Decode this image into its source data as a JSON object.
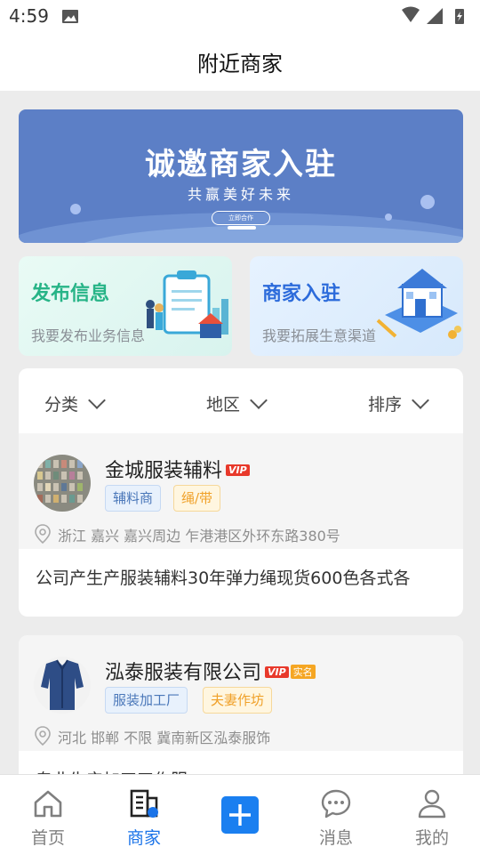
{
  "status": {
    "time": "4:59"
  },
  "header": {
    "title": "附近商家"
  },
  "banner": {
    "title": "诚邀商家入驻",
    "subtitle": "共赢美好未来",
    "button": "立即合作"
  },
  "cards": [
    {
      "title": "发布信息",
      "subtitle": "我要发布业务信息"
    },
    {
      "title": "商家入驻",
      "subtitle": "我要拓展生意渠道"
    }
  ],
  "filters": [
    {
      "label": "分类"
    },
    {
      "label": "地区"
    },
    {
      "label": "排序"
    }
  ],
  "merchants": [
    {
      "name": "金城服装辅料",
      "vip": "VIP",
      "tags": [
        "辅料商",
        "绳/带"
      ],
      "address": "浙江 嘉兴 嘉兴周边 乍港港区外环东路380号",
      "description": "公司产生产服装辅料30年弹力绳现货600色各式各"
    },
    {
      "name": "泓泰服装有限公司",
      "vip": "VIP",
      "real_name": "实名",
      "tags": [
        "服装加工厂",
        "夫妻作坊"
      ],
      "address": "河北 邯郸 不限 冀南新区泓泰服饰",
      "description": "专业生产加工工作服"
    }
  ],
  "tabs": [
    {
      "label": "首页",
      "icon": "home-icon",
      "active": false
    },
    {
      "label": "商家",
      "icon": "building-icon",
      "active": true
    },
    {
      "label": "",
      "icon": "plus-icon",
      "active": false
    },
    {
      "label": "消息",
      "icon": "message-icon",
      "active": false
    },
    {
      "label": "我的",
      "icon": "user-icon",
      "active": false
    }
  ],
  "colors": {
    "accent": "#1a73e8",
    "green": "#27b487",
    "vip": "#e8392b",
    "banner": "#5c7fc6"
  }
}
